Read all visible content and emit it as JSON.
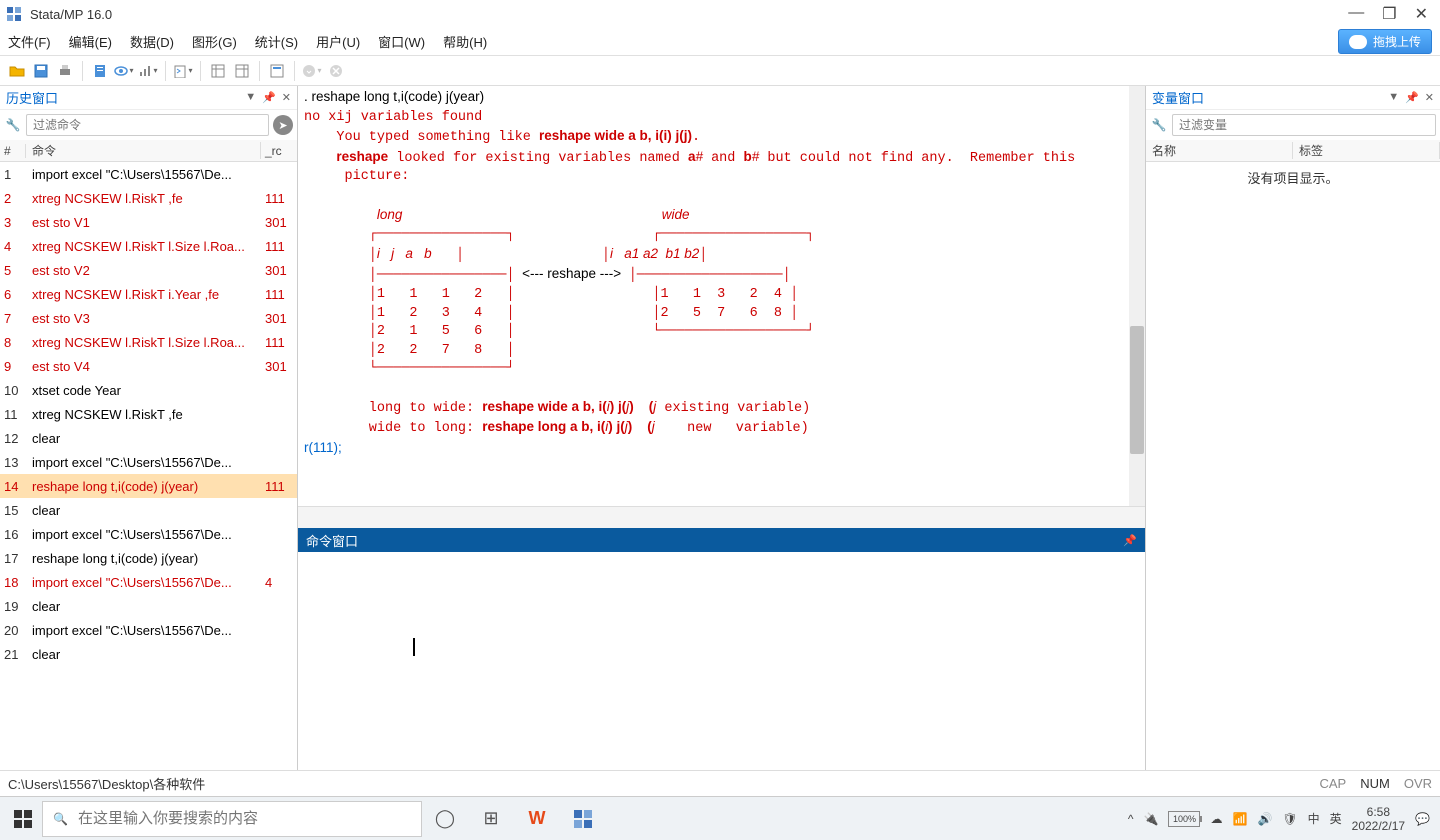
{
  "titlebar": {
    "title": "Stata/MP 16.0"
  },
  "menu": [
    "文件(F)",
    "编辑(E)",
    "数据(D)",
    "图形(G)",
    "统计(S)",
    "用户(U)",
    "窗口(W)",
    "帮助(H)"
  ],
  "cloud_btn": "拖拽上传",
  "history": {
    "title": "历史窗口",
    "filter_placeholder": "过滤命令",
    "col_num": "#",
    "col_cmd": "命令",
    "col_rc": "_rc",
    "rows": [
      {
        "n": "1",
        "cmd": "import excel \"C:\\Users\\15567\\De...",
        "rc": "",
        "err": false,
        "sel": false
      },
      {
        "n": "2",
        "cmd": "xtreg NCSKEW l.RiskT  ,fe",
        "rc": "111",
        "err": true,
        "sel": false
      },
      {
        "n": "3",
        "cmd": "est sto V1",
        "rc": "301",
        "err": true,
        "sel": false
      },
      {
        "n": "4",
        "cmd": "xtreg NCSKEW l.RiskT l.Size l.Roa...",
        "rc": "111",
        "err": true,
        "sel": false
      },
      {
        "n": "5",
        "cmd": "est sto V2",
        "rc": "301",
        "err": true,
        "sel": false
      },
      {
        "n": "6",
        "cmd": "xtreg NCSKEW l.RiskT i.Year ,fe",
        "rc": "111",
        "err": true,
        "sel": false
      },
      {
        "n": "7",
        "cmd": "est sto V3",
        "rc": "301",
        "err": true,
        "sel": false
      },
      {
        "n": "8",
        "cmd": "xtreg NCSKEW l.RiskT l.Size l.Roa...",
        "rc": "111",
        "err": true,
        "sel": false
      },
      {
        "n": "9",
        "cmd": "est sto V4",
        "rc": "301",
        "err": true,
        "sel": false
      },
      {
        "n": "10",
        "cmd": "xtset code Year",
        "rc": "",
        "err": false,
        "sel": false
      },
      {
        "n": "11",
        "cmd": "xtreg NCSKEW l.RiskT  ,fe",
        "rc": "",
        "err": false,
        "sel": false
      },
      {
        "n": "12",
        "cmd": "clear",
        "rc": "",
        "err": false,
        "sel": false
      },
      {
        "n": "13",
        "cmd": "import excel \"C:\\Users\\15567\\De...",
        "rc": "",
        "err": false,
        "sel": false
      },
      {
        "n": "14",
        "cmd": "reshape long t,i(code) j(year)",
        "rc": "111",
        "err": true,
        "sel": true
      },
      {
        "n": "15",
        "cmd": "clear",
        "rc": "",
        "err": false,
        "sel": false
      },
      {
        "n": "16",
        "cmd": "import excel \"C:\\Users\\15567\\De...",
        "rc": "",
        "err": false,
        "sel": false
      },
      {
        "n": "17",
        "cmd": "reshape long t,i(code) j(year)",
        "rc": "",
        "err": false,
        "sel": false
      },
      {
        "n": "18",
        "cmd": "import excel \"C:\\Users\\15567\\De...",
        "rc": "4",
        "err": true,
        "sel": false
      },
      {
        "n": "19",
        "cmd": "clear",
        "rc": "",
        "err": false,
        "sel": false
      },
      {
        "n": "20",
        "cmd": "import excel \"C:\\Users\\15567\\De...",
        "rc": "",
        "err": false,
        "sel": false
      },
      {
        "n": "21",
        "cmd": "clear",
        "rc": "",
        "err": false,
        "sel": false
      }
    ]
  },
  "results": {
    "command_echo": ". reshape long t,i(code) j(year)",
    "err_line1": "no xij variables found",
    "err_line2a": "    You typed something like ",
    "err_line2b": "reshape wide a b, i(i) j(j)",
    "err_line2c": ".",
    "err_line3a": "    ",
    "err_line3b": "reshape",
    "err_line3c": " looked for existing variables named ",
    "err_line3d": "a",
    "err_line3e": "#",
    "err_line3f": " and ",
    "err_line3g": "b",
    "err_line3h": "#",
    "err_line3i": " but could not find any.  Remember this",
    "err_line4": "     picture:",
    "long_label": "long",
    "wide_label": "wide",
    "long_header": "          i   j   a   b",
    "long_rows": [
      "          1   1   1   2",
      "          1   2   3   4",
      "          2   1   5   6",
      "          2   2   7   8"
    ],
    "wide_header": "          i   a1 a2  b1 b2",
    "wide_rows": [
      "          1   1  3   2  4",
      "          2   5  7   6  8"
    ],
    "reshape_arrow": "  <--- reshape --->  ",
    "hint1a": "        long to wide: ",
    "hint1b": "reshape wide a b, i(",
    "hint1c": "i",
    "hint1d": ") j(",
    "hint1e": "j",
    "hint1f": ")    (",
    "hint1g": "j",
    "hint1h": " existing variable)",
    "hint2a": "        wide to long: ",
    "hint2b": "reshape long a b, i(",
    "hint2c": "i",
    "hint2d": ") j(",
    "hint2e": "j",
    "hint2f": ")    (",
    "hint2g": "j",
    "hint2h": "    new   variable)",
    "rc_line": "r(111);"
  },
  "cmd_window_title": "命令窗口",
  "vars": {
    "title": "变量窗口",
    "filter_placeholder": "过滤变量",
    "col_name": "名称",
    "col_label": "标签",
    "empty": "没有项目显示。"
  },
  "status": {
    "path": "C:\\Users\\15567\\Desktop\\各种软件",
    "cap": "CAP",
    "num": "NUM",
    "ovr": "OVR"
  },
  "taskbar": {
    "search_placeholder": "在这里输入你要搜索的内容",
    "battery": "100%",
    "ime1": "中",
    "ime2": "英",
    "time": "6:58",
    "date": "2022/2/17"
  }
}
